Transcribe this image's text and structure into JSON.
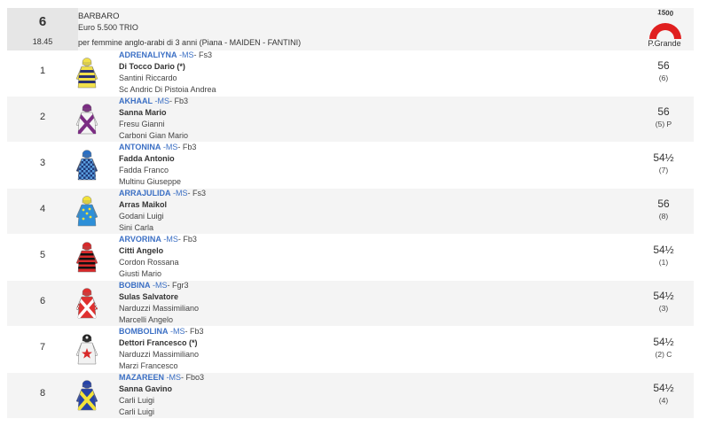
{
  "race": {
    "number": "6",
    "time": "18.45",
    "name": "BARBARO",
    "prize": "Euro 5.500 TRIO",
    "description": "per femmine anglo-arabi di 3 anni (Piana -  MAIDEN  - FANTINI)",
    "distance_label": "1500",
    "track": "P.Grande",
    "colors": {
      "track_icon": "#e01f1f",
      "horse_name": "#3b6fc4",
      "header_bg": "#f4f4f4",
      "race_box_bg": "#e6e6e6"
    }
  },
  "runners": [
    {
      "num": "1",
      "horse": "ADRENALIYNA",
      "suffix": " -MS",
      "cat": "- Fs3",
      "jockey": "Di Tocco Dario (*)",
      "trainer": "Santini Riccardo",
      "owner": "Sc Andric Di Pistoia Andrea",
      "weight": "56",
      "draw": "(6)",
      "silk": "yellow-navy-hoops-icon"
    },
    {
      "num": "2",
      "horse": "AKHAAL",
      "suffix": " -MS",
      "cat": "- Fb3",
      "jockey": "Sanna Mario",
      "trainer": "Fresu Gianni",
      "owner": "Carboni Gian Mario",
      "weight": "56",
      "draw": "(5) P",
      "silk": "white-purple-cross-icon"
    },
    {
      "num": "3",
      "horse": "ANTONINA",
      "suffix": " -MS",
      "cat": "- Fb3",
      "jockey": "Fadda Antonio",
      "trainer": "Fadda Franco",
      "owner": "Multinu Giuseppe",
      "weight": "54½",
      "draw": "(7)",
      "silk": "blue-checks-icon"
    },
    {
      "num": "4",
      "horse": "ARRAJULIDA",
      "suffix": " -MS",
      "cat": "- Fs3",
      "jockey": "Arras Maikol",
      "trainer": "Godani Luigi",
      "owner": "Sini Carla",
      "weight": "56",
      "draw": "(8)",
      "silk": "blue-yellow-stars-icon"
    },
    {
      "num": "5",
      "horse": "ARVORINA",
      "suffix": " -MS",
      "cat": "- Fb3",
      "jockey": "Citti Angelo",
      "trainer": "Cordon Rossana",
      "owner": "Giusti Mario",
      "weight": "54½",
      "draw": "(1)",
      "silk": "red-black-hoops-icon"
    },
    {
      "num": "6",
      "horse": "BOBINA",
      "suffix": " -MS",
      "cat": "- Fgr3",
      "jockey": "Sulas Salvatore",
      "trainer": "Narduzzi Massimiliano",
      "owner": "Marcelli Angelo",
      "weight": "54½",
      "draw": "(3)",
      "silk": "red-white-cross-icon"
    },
    {
      "num": "7",
      "horse": "BOMBOLINA",
      "suffix": " -MS",
      "cat": "- Fb3",
      "jockey": "Dettori Francesco (*)",
      "trainer": "Narduzzi Massimiliano",
      "owner": "Marzi Francesco",
      "weight": "54½",
      "draw": "(2) C",
      "silk": "white-red-star-icon"
    },
    {
      "num": "8",
      "horse": "MAZAREEN",
      "suffix": " -MS",
      "cat": "- Fbo3",
      "jockey": "Sanna Gavino",
      "trainer": "Carli Luigi",
      "owner": "Carli Luigi",
      "weight": "54½",
      "draw": "(4)",
      "silk": "blue-yellow-cross-icon"
    }
  ]
}
